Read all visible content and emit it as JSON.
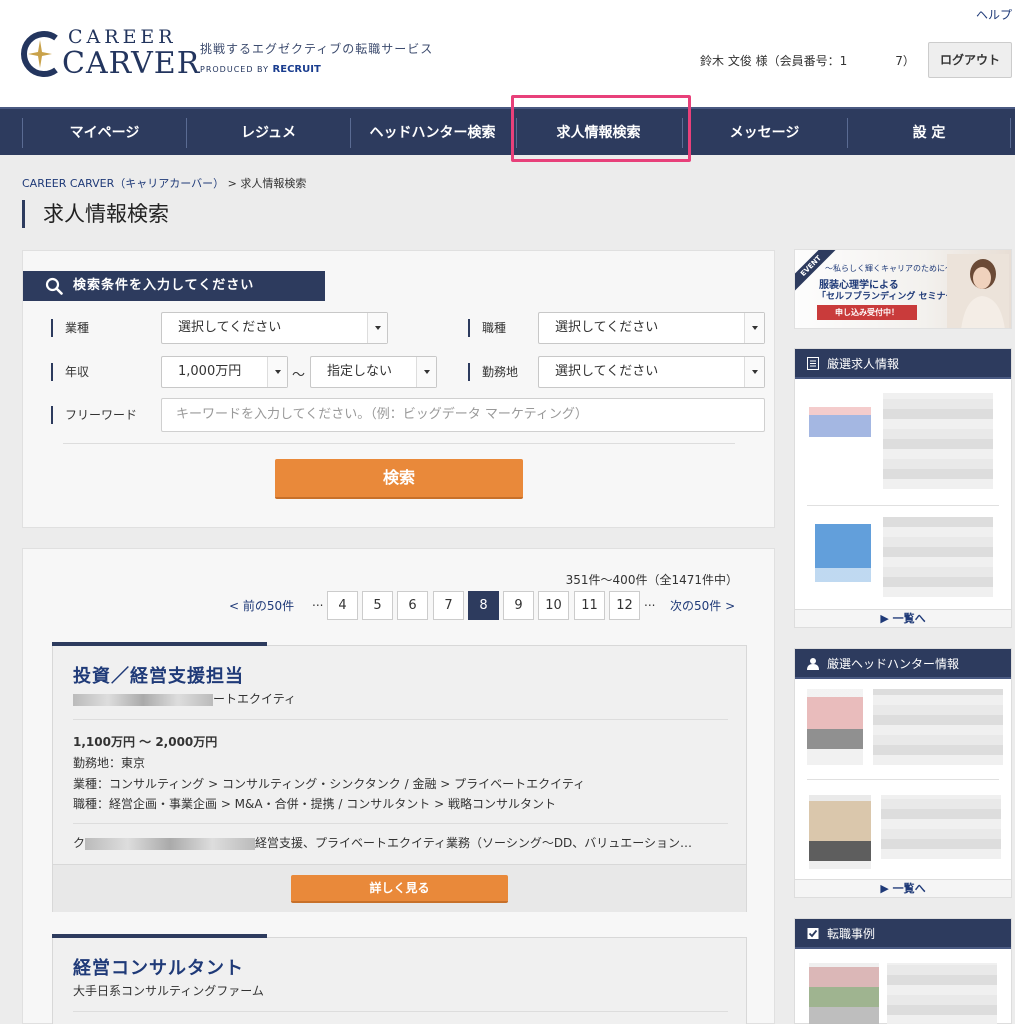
{
  "header": {
    "help_label": "ヘルプ",
    "logo_line1": "CAREER",
    "logo_line2": "CARVER",
    "tagline": "挑戦するエグゼクティブの転職サービス",
    "produced_by": "PRODUCED BY",
    "recruit": "RECRUIT",
    "user_info": "鈴木 文俊 様（会員番号：1　　　　7）",
    "logout_label": "ログアウト"
  },
  "nav": {
    "items": [
      {
        "label": "マイページ"
      },
      {
        "label": "レジュメ"
      },
      {
        "label": "ヘッドハンター検索"
      },
      {
        "label": "求人情報検索"
      },
      {
        "label": "メッセージ"
      },
      {
        "label": "設 定"
      }
    ],
    "active_index": 3
  },
  "breadcrumb": {
    "home": "CAREER CARVER（キャリアカーバー）",
    "separator": ">",
    "current": "求人情報検索"
  },
  "page_title": "求人情報検索",
  "search": {
    "header": "検索条件を入力してください",
    "industry_label": "業種",
    "industry_value": "選択してください",
    "job_type_label": "職種",
    "job_type_value": "選択してください",
    "salary_label": "年収",
    "salary_min": "1,000万円",
    "salary_sep": "〜",
    "salary_max": "指定しない",
    "location_label": "勤務地",
    "location_value": "選択してください",
    "freeword_label": "フリーワード",
    "freeword_placeholder": "キーワードを入力してください。（例：ビッグデータ  マーケティング）",
    "submit_label": "検索"
  },
  "results": {
    "count_text": "351件〜400件（全1471件中）",
    "prev_label": "< 前の50件",
    "next_label": "次の50件 >",
    "ellipsis": "...",
    "pages": [
      "4",
      "5",
      "6",
      "7",
      "8",
      "9",
      "10",
      "11",
      "12"
    ],
    "current_page": "8",
    "jobs": [
      {
        "title": "投資／経営支援担当",
        "company_suffix": "ートエクイティ",
        "salary": "1,100万円 〜 2,000万円",
        "location": "勤務地：東京",
        "industry": "業種：コンサルティング > コンサルティング・シンクタンク / 金融 > プライベートエクイティ",
        "job_type": "職種：経営企画・事業企画 > M&A・合併・提携 / コンサルタント > 戦略コンサルタント",
        "desc_prefix": "ク",
        "desc": "経営支援、プライベートエクイティ業務（ソーシング〜DD、バリュエーション…",
        "detail_label": "詳しく見る"
      },
      {
        "title": "経営コンサルタント",
        "company": "大手日系コンサルティングファーム"
      }
    ]
  },
  "sidebar": {
    "event": {
      "tag": "EVENT",
      "line1": "〜私らしく輝くキャリアのために〜",
      "line2": "服装心理学による",
      "line3": "「セルフブランディング セミナー」",
      "cta": "申し込み受付中！"
    },
    "featured_jobs": {
      "header": "厳選求人情報",
      "more": "▶ 一覧へ"
    },
    "headhunters": {
      "header": "厳選ヘッドハンター情報",
      "more": "▶ 一覧へ"
    },
    "cases": {
      "header": "転職事例"
    }
  },
  "colors": {
    "navy": "#2d3b5e",
    "orange": "#e9893a",
    "highlight": "#e8407a",
    "link": "#1f3a78"
  }
}
